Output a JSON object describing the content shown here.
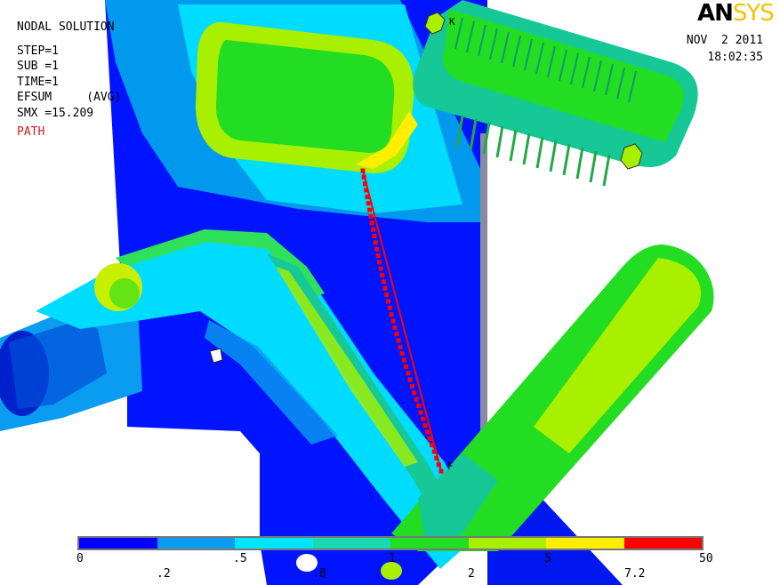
{
  "solution": {
    "title": "NODAL SOLUTION",
    "step": "STEP=1",
    "sub": "SUB =1",
    "time": "TIME=1",
    "efsum": "EFSUM     (AVG)",
    "smx": "SMX =15.209",
    "path": "PATH"
  },
  "logo": {
    "part1": "AN",
    "part2": "SYS"
  },
  "date": "NOV  2 2011",
  "clock": "18:02:35",
  "path_labels": {
    "start": "K",
    "end": "F"
  },
  "legend": {
    "colors": [
      "#0000ff",
      "#0a9cf0",
      "#00e4ff",
      "#1ad8b0",
      "#22dd22",
      "#a8f000",
      "#ffee00",
      "#ff0000"
    ],
    "top_labels": [
      "0",
      ".5",
      "1",
      "5",
      "50"
    ],
    "bottom_labels": [
      ".2",
      ".8",
      "2",
      "7.2"
    ]
  }
}
